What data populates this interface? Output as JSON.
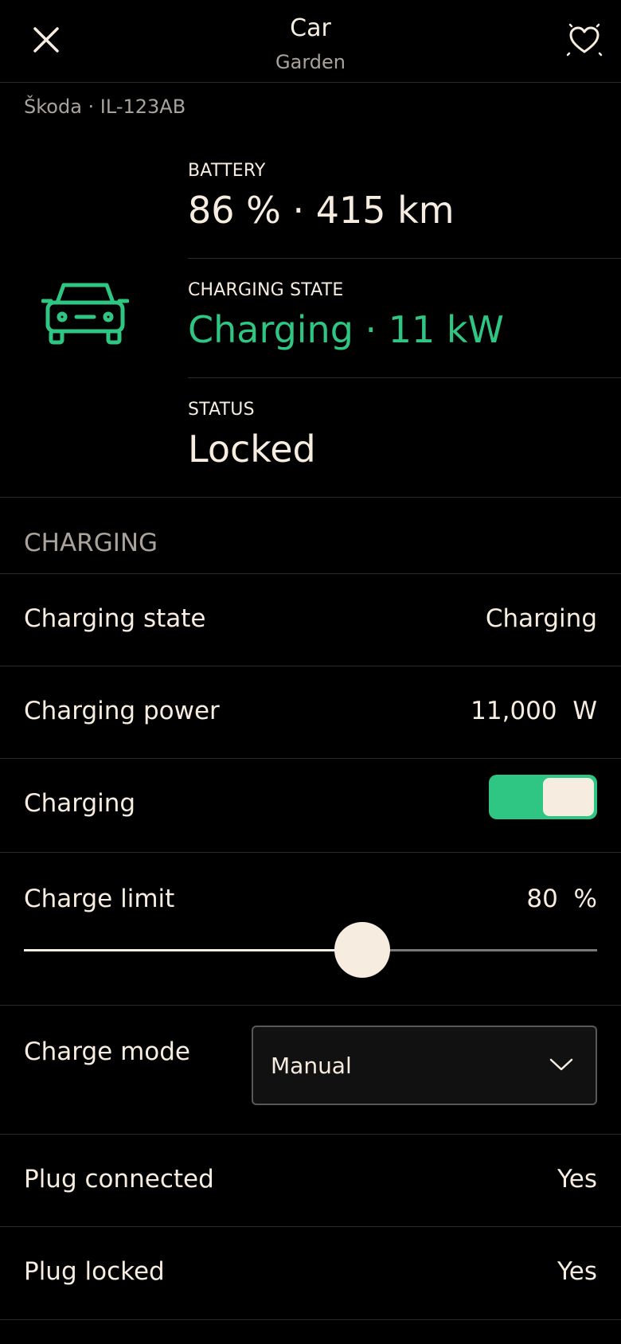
{
  "header": {
    "title": "Car",
    "subtitle": "Garden",
    "close_icon": "close-icon",
    "favorite_icon": "heart-icon"
  },
  "vehicle": {
    "id_line": "Škoda · IL-123AB",
    "icon": "car-icon",
    "icon_color": "#2fc583"
  },
  "battery": {
    "label": "BATTERY",
    "value": "86 % · 415 km"
  },
  "charging_state_summary": {
    "label": "CHARGING STATE",
    "value": "Charging · 11 kW",
    "color": "#2fc583"
  },
  "status": {
    "label": "STATUS",
    "value": "Locked"
  },
  "section": {
    "title": "CHARGING"
  },
  "rows": {
    "charging_state": {
      "label": "Charging state",
      "value": "Charging"
    },
    "charging_power": {
      "label": "Charging power",
      "value": "11,000  W"
    },
    "charging_toggle": {
      "label": "Charging",
      "on": true,
      "color": "#2fc583"
    },
    "charge_limit": {
      "label": "Charge limit",
      "value": "80  %",
      "fraction": 0.59
    },
    "charge_mode": {
      "label": "Charge mode",
      "selected": "Manual",
      "chevron_icon": "chevron-down-icon"
    },
    "plug_connected": {
      "label": "Plug connected",
      "value": "Yes"
    },
    "plug_locked": {
      "label": "Plug locked",
      "value": "Yes"
    }
  }
}
